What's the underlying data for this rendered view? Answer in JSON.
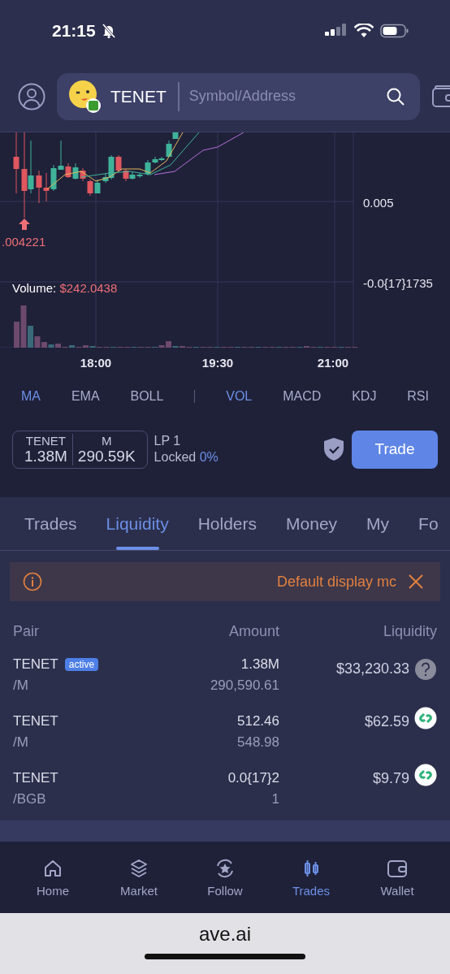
{
  "status_bar": {
    "time": "21:15"
  },
  "header": {
    "token": "TENET",
    "search": {
      "placeholder": "Symbol/Address"
    }
  },
  "chart": {
    "y_labels": [
      "0.005",
      "-0.0{17}1735"
    ],
    "x_labels": [
      "18:00",
      "19:30",
      "21:00"
    ],
    "low_marker": ".004221",
    "volume": {
      "label": "Volume:",
      "value": "$242.0438"
    }
  },
  "indicators": {
    "main": [
      {
        "label": "MA",
        "selected": true
      },
      {
        "label": "EMA",
        "selected": false
      },
      {
        "label": "BOLL",
        "selected": false
      }
    ],
    "sub": [
      {
        "label": "VOL",
        "selected": true
      },
      {
        "label": "MACD",
        "selected": false
      },
      {
        "label": "KDJ",
        "selected": false
      },
      {
        "label": "RSI",
        "selected": false
      }
    ]
  },
  "pool": {
    "tokens": [
      {
        "symbol": "TENET",
        "amount": "1.38M"
      },
      {
        "symbol": "M",
        "amount": "290.59K"
      }
    ],
    "lp": "LP 1",
    "locked_label": "Locked",
    "locked_value": "0%",
    "trade_button": "Trade"
  },
  "tabs": [
    {
      "label": "Trades",
      "selected": false
    },
    {
      "label": "Liquidity",
      "selected": true
    },
    {
      "label": "Holders",
      "selected": false
    },
    {
      "label": "Money",
      "selected": false
    },
    {
      "label": "My",
      "selected": false
    },
    {
      "label": "Fo",
      "selected": false
    }
  ],
  "notice": {
    "text": "Default display mc"
  },
  "table": {
    "columns": [
      "Pair",
      "Amount",
      "Liquidity"
    ],
    "rows": [
      {
        "pair": "TENET",
        "badge": "active",
        "quote": "/M",
        "amount": "1.38M",
        "amount_2": "290,590.61",
        "liquidity": "$33,230.33",
        "kind": "question"
      },
      {
        "pair": "TENET",
        "quote": "/M",
        "amount": "512.46",
        "amount_2": "548.98",
        "liquidity": "$62.59",
        "kind": "link"
      },
      {
        "pair": "TENET",
        "quote": "/BGB",
        "amount": "0.0{17}2",
        "amount_2": "1",
        "liquidity": "$9.79",
        "kind": "link"
      }
    ]
  },
  "bottom_nav": [
    {
      "label": "Home",
      "kind": "home",
      "selected": false
    },
    {
      "label": "Market",
      "kind": "layers",
      "selected": false
    },
    {
      "label": "Follow",
      "kind": "follow",
      "selected": false
    },
    {
      "label": "Trades",
      "kind": "candles",
      "selected": true
    },
    {
      "label": "Wallet",
      "kind": "wallet",
      "selected": false
    }
  ],
  "browser": {
    "url": "ave.ai"
  }
}
